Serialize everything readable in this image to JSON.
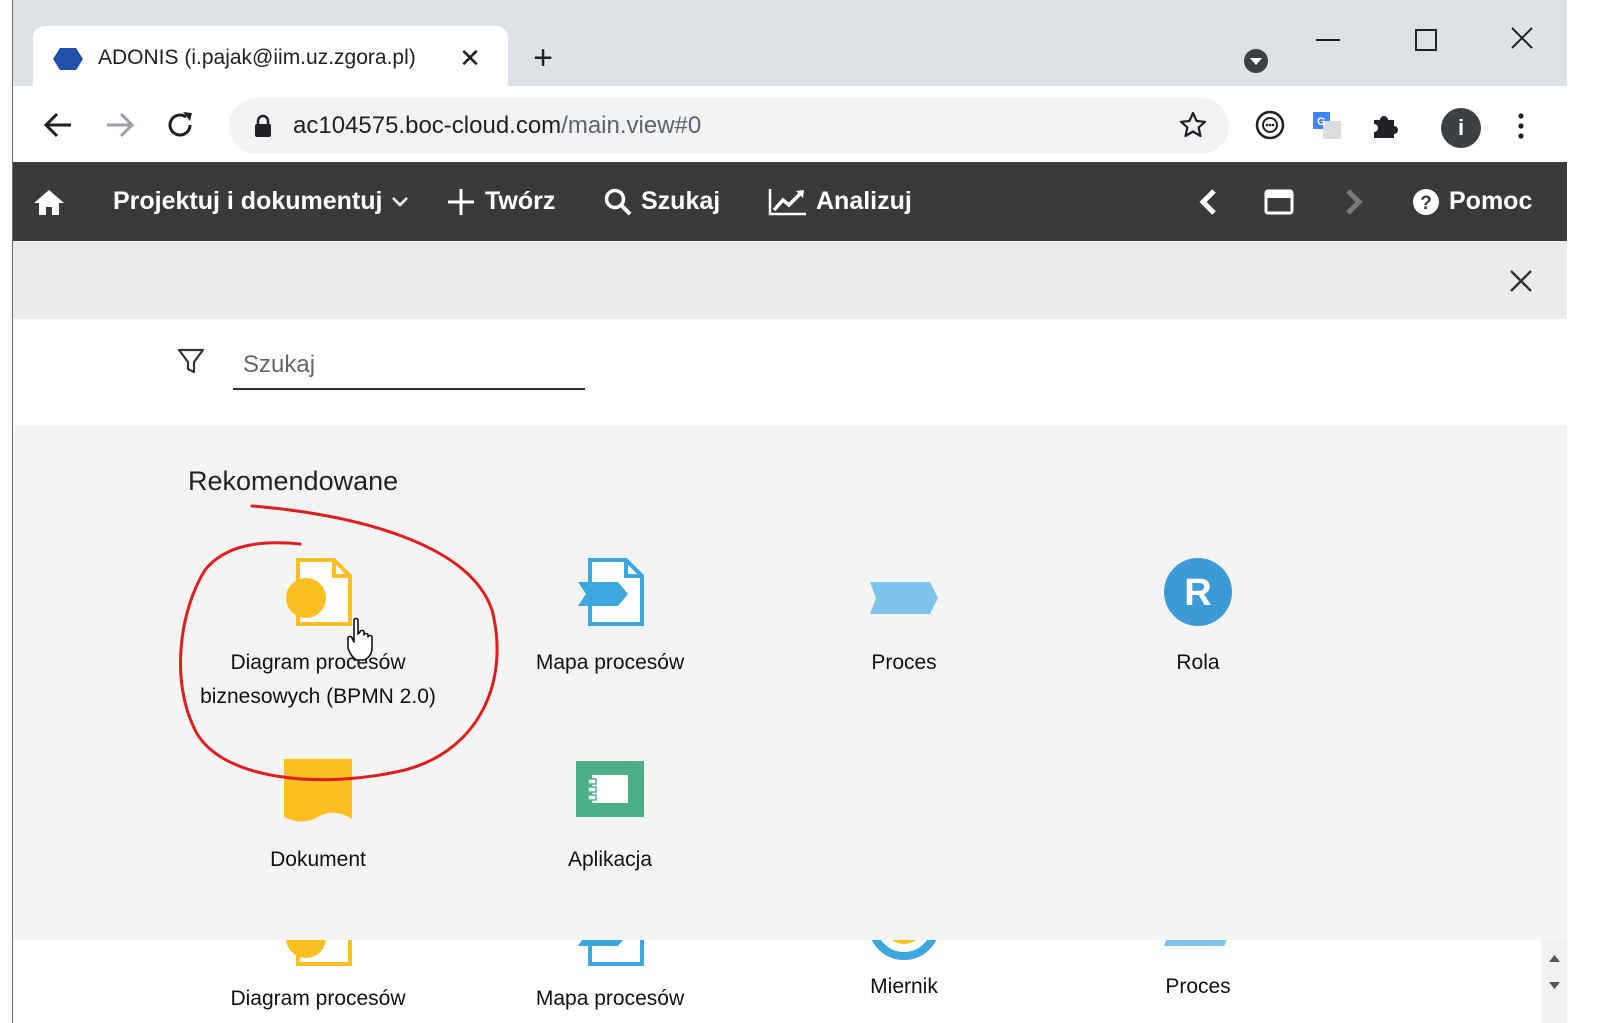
{
  "browser": {
    "tab_title": "ADONIS (i.pajak@iim.uz.zgora.pl)",
    "tab_close": "✕",
    "new_tab": "+",
    "url_host": "ac104575.boc-cloud.com",
    "url_path": "/main.view#0",
    "profile_initial": "i"
  },
  "appnav": {
    "design": "Projektuj i dokumentuj",
    "create": "Twórz",
    "search": "Szukaj",
    "analyze": "Analizuj",
    "help": "Pomoc"
  },
  "search": {
    "placeholder": "Szukaj"
  },
  "section_title": "Rekomendowane",
  "recommended": [
    {
      "label": "Diagram procesów biznesowych (BPMN 2.0)",
      "icon": "bpmn-diagram-icon",
      "color": "#fbbf24"
    },
    {
      "label": "Mapa procesów",
      "icon": "process-map-icon",
      "color": "#3ea7e0"
    },
    {
      "label": "Proces",
      "icon": "process-icon",
      "color": "#7ec3ea"
    },
    {
      "label": "Rola",
      "icon": "role-icon",
      "color": "#3d9bd6"
    },
    {
      "label": "Dokument",
      "icon": "document-icon",
      "color": "#fbbf24"
    },
    {
      "label": "Aplikacja",
      "icon": "application-icon",
      "color": "#4caf88"
    }
  ],
  "all_items": [
    {
      "label": "Diagram procesów",
      "icon": "bpmn-diagram-icon"
    },
    {
      "label": "Mapa procesów",
      "icon": "process-map-icon"
    },
    {
      "label": "Miernik",
      "icon": "indicator-icon"
    },
    {
      "label": "Proces",
      "icon": "process-icon"
    }
  ],
  "colors": {
    "appnav_bg": "#3a3a3a",
    "annotation": "#e01e1e"
  }
}
